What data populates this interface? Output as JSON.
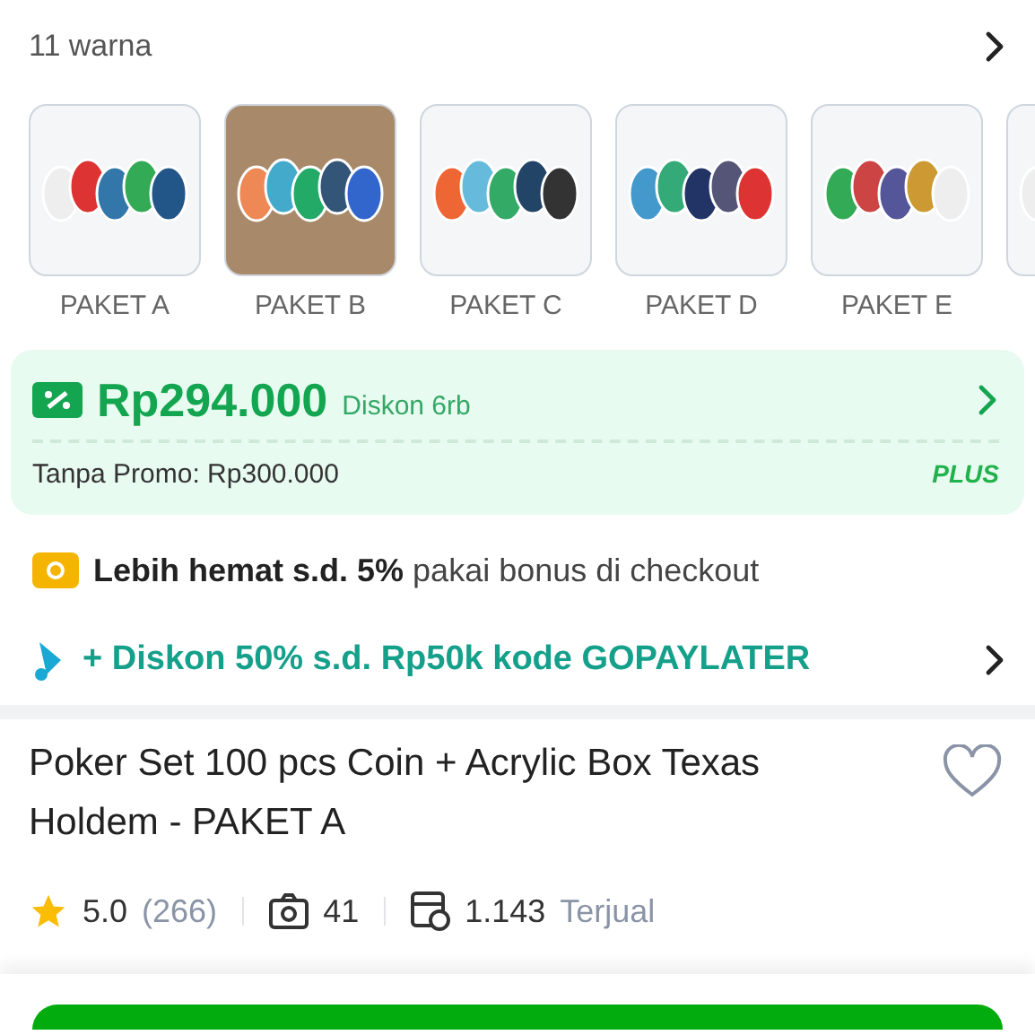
{
  "variants": {
    "count_label": "11 warna",
    "items": [
      {
        "kind": "labeled",
        "label": "PAKET A"
      },
      {
        "kind": "labeled",
        "label": "PAKET B"
      },
      {
        "kind": "labeled",
        "label": "PAKET C"
      },
      {
        "kind": "labeled",
        "label": "PAKET D"
      },
      {
        "kind": "labeled",
        "label": "PAKET E"
      },
      {
        "kind": "image_only"
      }
    ]
  },
  "price_card": {
    "price": "Rp294.000",
    "discount": "Diskon 6rb",
    "original": "Tanpa Promo: Rp300.000",
    "badge": "PLUS"
  },
  "bonus": {
    "text": "**Lebih hemat s.d. 5%** pakai bonus di checkout"
  },
  "paylater": {
    "text": "+ Diskon 50% s.d. Rp50k kode GOPAYLATER"
  },
  "product": {
    "title": "Poker Set 100 pcs Coin + Acrylic Box Texas Holdem - PAKET A",
    "favorite": false
  },
  "stats": {
    "rating": "5.0",
    "reviews": "(266)",
    "photos": "41",
    "sold": "1.143",
    "sold_label": "Terjual"
  }
}
